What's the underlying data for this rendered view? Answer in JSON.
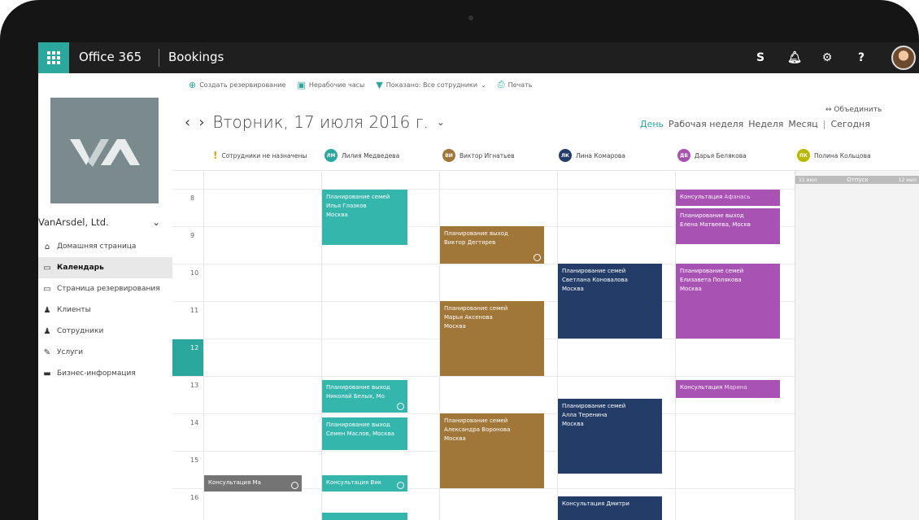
{
  "topbar": {
    "suite_name": "Office 365",
    "app_name": "Bookings",
    "icons": [
      "skype-icon",
      "bell-icon",
      "gear-icon",
      "help-icon"
    ],
    "help_label": "?"
  },
  "sidebar": {
    "business_name": "VanArsdel, Ltd.",
    "items": [
      {
        "label": "Домашняя страница",
        "icon": "home-icon"
      },
      {
        "label": "Календарь",
        "icon": "calendar-icon",
        "active": true
      },
      {
        "label": "Страница резервирования",
        "icon": "booking-page-icon"
      },
      {
        "label": "Клиенты",
        "icon": "customers-icon"
      },
      {
        "label": "Сотрудники",
        "icon": "staff-icon"
      },
      {
        "label": "Услуги",
        "icon": "services-icon"
      },
      {
        "label": "Бизнес-информация",
        "icon": "business-info-icon"
      }
    ]
  },
  "toolbar": {
    "new_booking": "Создать резервирование",
    "time_off": "Нерабочие часы",
    "filter": "Показано: Все сотрудники",
    "print": "Печать"
  },
  "header": {
    "date": "Вторник, 17 июля 2016 г.",
    "merge": "Объединить",
    "views": {
      "day": "День",
      "work_week": "Рабочая неделя",
      "week": "Неделя",
      "month": "Месяц",
      "today": "Сегодня"
    }
  },
  "staff": [
    {
      "initials": "",
      "name": "Сотрудники не назначены",
      "color": "#e0a000"
    },
    {
      "initials": "ЛМ",
      "name": "Лилия Медведева",
      "color": "#2aa89e"
    },
    {
      "initials": "ВИ",
      "name": "Виктор Игнатьев",
      "color": "#a17639"
    },
    {
      "initials": "ЛК",
      "name": "Лина Комарова",
      "color": "#243d68"
    },
    {
      "initials": "ДБ",
      "name": "Дарья Белякова",
      "color": "#a852b3"
    },
    {
      "initials": "ПК",
      "name": "Полина Кольцова",
      "color": "#b8b800"
    }
  ],
  "hours": [
    "8",
    "9",
    "10",
    "11",
    "12",
    "13",
    "14",
    "15",
    "16"
  ],
  "current_hour": "12",
  "vacation": {
    "left": "11 июл",
    "label": "Отпуск",
    "right": "12 июл"
  },
  "appointments": [
    {
      "title": "Планирование семей",
      "line2": "Илья Глазков",
      "line3": "Москва"
    },
    {
      "title": "Планирование выход",
      "line2": "Виктор Дегтярев",
      "line3": ""
    },
    {
      "title": "Планирование семей",
      "line2": "Марья Аксенова",
      "line3": "Москва"
    },
    {
      "title": "Планирование семей",
      "line2": "Светлана Коновалова",
      "line3": "Москва"
    },
    {
      "title": "Консультация",
      "line2": "Афанась",
      "line3": ""
    },
    {
      "title": "Планирование выход",
      "line2": "Елена Матвеева, Москв",
      "line3": ""
    },
    {
      "title": "Планирование семей",
      "line2": "Елизавета Полякова",
      "line3": "Москва"
    },
    {
      "title": "Планирование выход",
      "line2": "Николай Белых, Мо",
      "line3": ""
    },
    {
      "title": "Планирование выход",
      "line2": "Семен Маслов, Москва",
      "line3": ""
    },
    {
      "title": "Планирование семей",
      "line2": "Александра Воронова",
      "line3": "Москва"
    },
    {
      "title": "Планирование семей",
      "line2": "Алла Теренина",
      "line3": "Москва"
    },
    {
      "title": "Консультация",
      "line2": "Марина",
      "line3": ""
    },
    {
      "title": "Консультация",
      "line2": "Ма",
      "line3": ""
    },
    {
      "title": "Консультация",
      "line2": "Вик",
      "line3": ""
    },
    {
      "title": "Консультация",
      "line2": "Дмитри",
      "line3": ""
    }
  ]
}
